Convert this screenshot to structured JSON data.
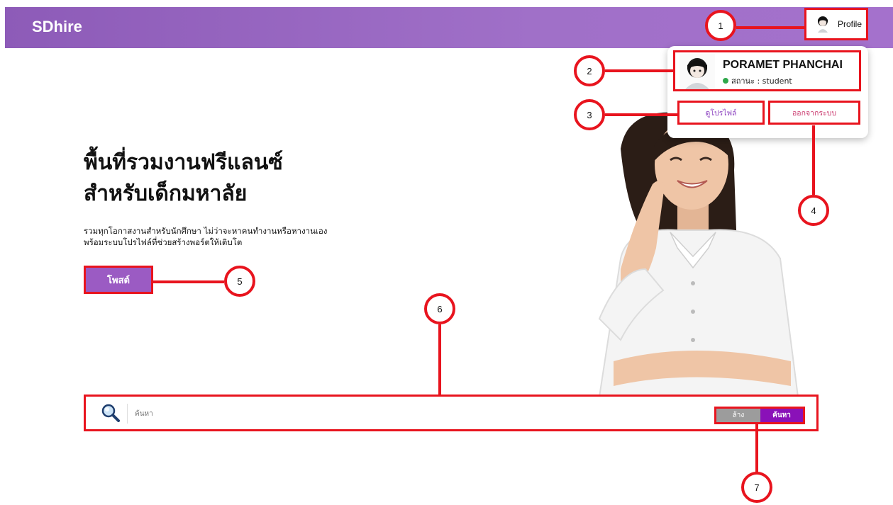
{
  "header": {
    "brand": "SDhire",
    "profile_label": "Profile"
  },
  "hero": {
    "title_line1": "พื้นที่รวมงานฟรีแลนซ์",
    "title_line2": "สำหรับเด็กมหาลัย",
    "subtitle_line1": "รวมทุกโอกาสงานสำหรับนักศึกษา ไม่ว่าจะหาคนทำงานหรือหางานเอง",
    "subtitle_line2": "พร้อมระบบโปรไฟล์ที่ช่วยสร้างพอร์ตให้เติบโต",
    "post_button": "โพสต์"
  },
  "dropdown": {
    "user_name": "PORAMET PHANCHAI",
    "status_text": "สถานะ : student",
    "view_profile": "ดูโปรไฟล์",
    "logout": "ออกจากระบบ"
  },
  "search": {
    "placeholder": "ค้นหา",
    "clear_label": "ล้าง",
    "search_label": "ค้นหา"
  },
  "callouts": [
    "1",
    "2",
    "3",
    "4",
    "5",
    "6",
    "7"
  ],
  "colors": {
    "header_purple": "#9d6bc6",
    "accent_purple": "#8a11b8",
    "annotation_red": "#e8141e",
    "status_green": "#2ea84a"
  },
  "icons": {
    "avatar": "avatar-icon",
    "search": "search-icon",
    "status": "status-dot-icon"
  }
}
